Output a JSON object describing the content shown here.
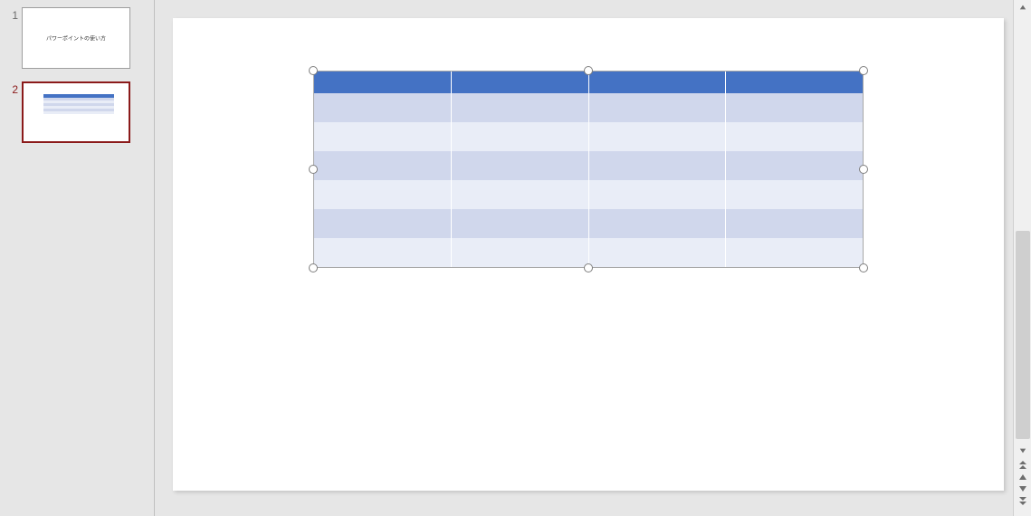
{
  "thumbnails": [
    {
      "number": "1",
      "selected": false,
      "title_text": "パワーポイントの使い方"
    },
    {
      "number": "2",
      "selected": true
    }
  ],
  "slide": {
    "table": {
      "columns": 4,
      "rows": 6,
      "header_cells": [
        "",
        "",
        "",
        ""
      ],
      "body": [
        [
          "",
          "",
          "",
          ""
        ],
        [
          "",
          "",
          "",
          ""
        ],
        [
          "",
          "",
          "",
          ""
        ],
        [
          "",
          "",
          "",
          ""
        ],
        [
          "",
          "",
          "",
          ""
        ],
        [
          "",
          "",
          "",
          ""
        ]
      ],
      "colors": {
        "header": "#4472C4",
        "band_a": "#d0d7ec",
        "band_b": "#e9edf7"
      },
      "selected": true
    }
  },
  "icons": {
    "scroll_up": "▲",
    "scroll_down": "▼"
  }
}
